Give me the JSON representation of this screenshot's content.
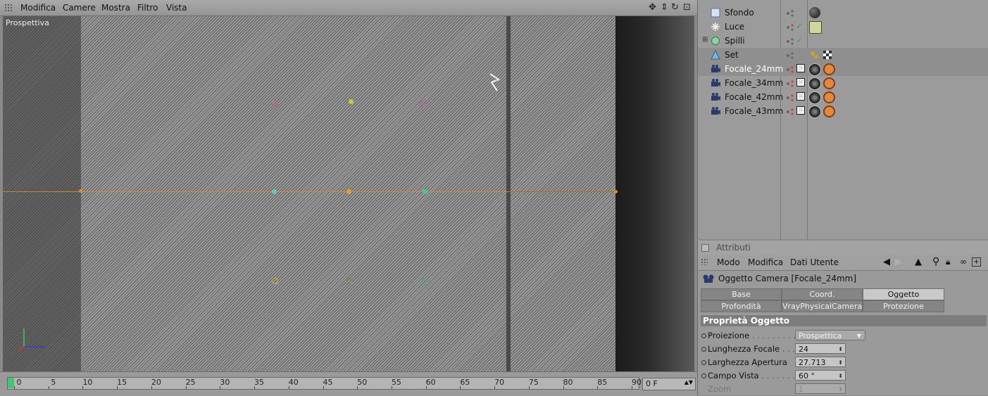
{
  "viewport": {
    "menu": [
      "Modifica",
      "Camere",
      "Mostra",
      "Filtro",
      "Vista"
    ],
    "label": "Prospettiva",
    "nav_icons": [
      "move-icon",
      "zoom-icon",
      "rotate-icon",
      "maximize-icon"
    ]
  },
  "timeline": {
    "ticks": [
      "0",
      "5",
      "10",
      "15",
      "20",
      "25",
      "30",
      "35",
      "40",
      "45",
      "50",
      "55",
      "60",
      "65",
      "70",
      "75",
      "80",
      "85",
      "90"
    ],
    "current_frame": "0 F"
  },
  "object_manager": {
    "items": [
      {
        "name": "Sfondo",
        "icon": "background-icon"
      },
      {
        "name": "Luce",
        "icon": "light-icon"
      },
      {
        "name": "Spilli",
        "icon": "null-group-icon"
      },
      {
        "name": "Set",
        "icon": "set-icon"
      },
      {
        "name": "Focale_24mm",
        "icon": "camera-icon"
      },
      {
        "name": "Focale_34mm",
        "icon": "camera-icon"
      },
      {
        "name": "Focale_42mm",
        "icon": "camera-icon"
      },
      {
        "name": "Focale_43mm",
        "icon": "camera-icon"
      }
    ]
  },
  "attributes": {
    "panel_title": "Attributi",
    "menu": [
      "Modo",
      "Modifica",
      "Dati Utente"
    ],
    "object_title": "Oggetto Camera [Focale_24mm]",
    "tabs_row1": [
      "Base",
      "Coord.",
      "Oggetto"
    ],
    "tabs_row2": [
      "Profondità",
      "VrayPhysicalCamera",
      "Protezione"
    ],
    "active_tab": "Oggetto",
    "section_title": "Proprietà Oggetto",
    "properties": [
      {
        "label": "Proiezione",
        "dots": " . . . . . . . . . .",
        "value": "Prospettica"
      },
      {
        "label": "Lunghezza Focale",
        "dots": " . . . .",
        "value": "24"
      },
      {
        "label": "Larghezza Apertura",
        "dots": "",
        "value": "27.713"
      },
      {
        "label": "Campo Vista",
        "dots": " . . . . . . . .",
        "value": "60 °"
      },
      {
        "label": "Zoom",
        "dots": "",
        "value": "1"
      }
    ]
  }
}
